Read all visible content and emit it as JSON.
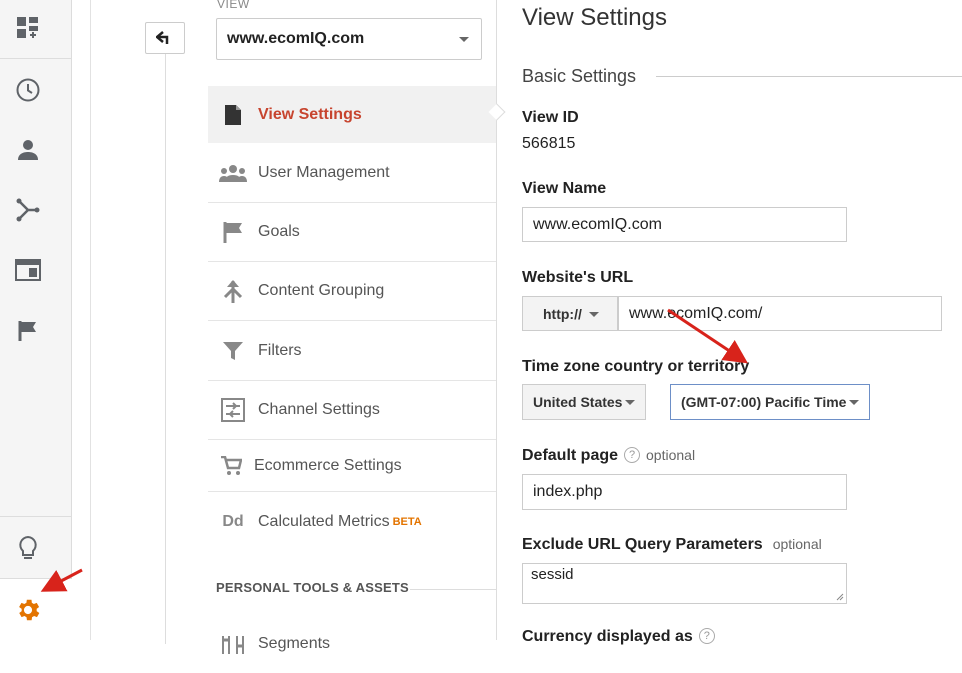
{
  "rail": {
    "icons": [
      "dashboard-add-icon",
      "clock-icon",
      "person-icon",
      "branch-icon",
      "browser-window-icon",
      "flag-icon",
      "lightbulb-icon",
      "gear-icon"
    ],
    "accent": "#e37400"
  },
  "view_selector": {
    "label": "VIEW",
    "selected": "www.ecomIQ.com"
  },
  "nav": {
    "items": [
      {
        "label": "View Settings",
        "icon": "document-icon",
        "active": true
      },
      {
        "label": "User Management",
        "icon": "users-icon"
      },
      {
        "label": "Goals",
        "icon": "flag-icon"
      },
      {
        "label": "Content Grouping",
        "icon": "merge-icon"
      },
      {
        "label": "Filters",
        "icon": "filter-icon"
      },
      {
        "label": "Channel Settings",
        "icon": "sliders-icon"
      },
      {
        "label": "Ecommerce Settings",
        "icon": "cart-icon"
      },
      {
        "label": "Calculated Metrics",
        "icon": "dd-icon",
        "badge": "BETA"
      }
    ],
    "section_heading": "PERSONAL TOOLS & ASSETS",
    "partial_item": "Segments"
  },
  "main": {
    "title": "View Settings",
    "section": "Basic Settings",
    "view_id_label": "View ID",
    "view_id": "566815",
    "view_name_label": "View Name",
    "view_name": "www.ecomIQ.com",
    "url_label": "Website's URL",
    "protocol": "http://",
    "url": "www.ecomIQ.com/",
    "timezone_label": "Time zone country or territory",
    "country": "United States",
    "timezone": "(GMT-07:00) Pacific Time",
    "default_page_label": "Default page",
    "help": "?",
    "optional": "optional",
    "default_page": "index.php",
    "exclude_label": "Exclude URL Query Parameters",
    "exclude_value": "sessid",
    "currency_label": "Currency displayed as"
  },
  "colors": {
    "active_nav": "#c7442e",
    "arrow": "#d8231b"
  }
}
